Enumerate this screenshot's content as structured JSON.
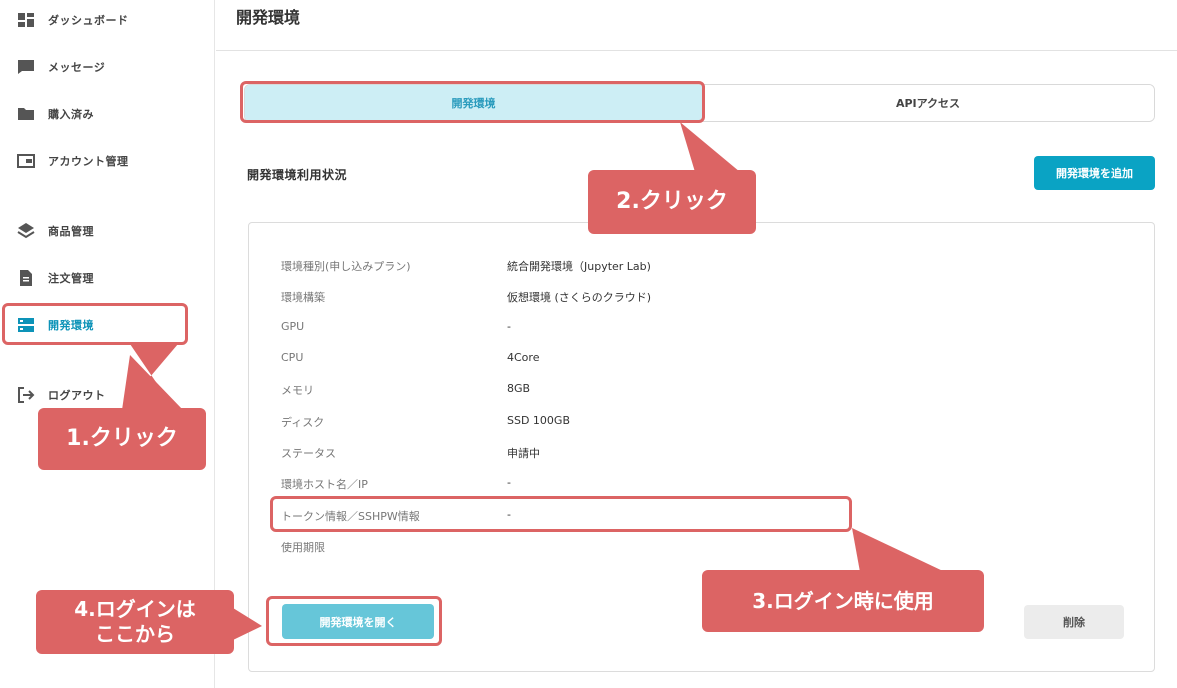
{
  "sidebar": {
    "items": [
      {
        "label": "ダッシュボード",
        "icon": "dashboard-icon"
      },
      {
        "label": "メッセージ",
        "icon": "message-icon"
      },
      {
        "label": "購入済み",
        "icon": "folder-icon"
      },
      {
        "label": "アカウント管理",
        "icon": "wallet-icon"
      },
      {
        "label": "商品管理",
        "icon": "layers-icon"
      },
      {
        "label": "注文管理",
        "icon": "document-icon"
      },
      {
        "label": "開発環境",
        "icon": "server-icon"
      },
      {
        "label": "ログアウト",
        "icon": "logout-icon"
      }
    ]
  },
  "header": {
    "title": "開発環境"
  },
  "tabs": [
    {
      "label": "開発環境",
      "active": true
    },
    {
      "label": "APIアクセス",
      "active": false
    }
  ],
  "main": {
    "section_title": "開発環境利用状況",
    "add_button": "開発環境を追加",
    "specs": [
      {
        "label": "環境種別(申し込みプラン)",
        "value": "統合開発環境（Jupyter Lab)"
      },
      {
        "label": "環境構築",
        "value": "仮想環境 (さくらのクラウド)"
      },
      {
        "label": "GPU",
        "value": "-"
      },
      {
        "label": "CPU",
        "value": "4Core"
      },
      {
        "label": "メモリ",
        "value": "8GB"
      },
      {
        "label": "ディスク",
        "value": "SSD 100GB"
      },
      {
        "label": "ステータス",
        "value": "申請中"
      },
      {
        "label": "環境ホスト名／IP",
        "value": "-"
      },
      {
        "label": "トークン情報／SSHPW情報",
        "value": "-"
      },
      {
        "label": "使用期限",
        "value": ""
      }
    ],
    "open_button": "開発環境を開く",
    "delete_button": "削除"
  },
  "annotations": {
    "step1": "1.クリック",
    "step2": "2.クリック",
    "step3": "3.ログイン時に使用",
    "step4_line1": "4.ログインは",
    "step4_line2": "ここから"
  },
  "colors": {
    "accent": "#0aa3c4",
    "active_tab_bg": "#cdeef5",
    "annotation": "#dc6464",
    "open_button": "#66c6d9"
  }
}
